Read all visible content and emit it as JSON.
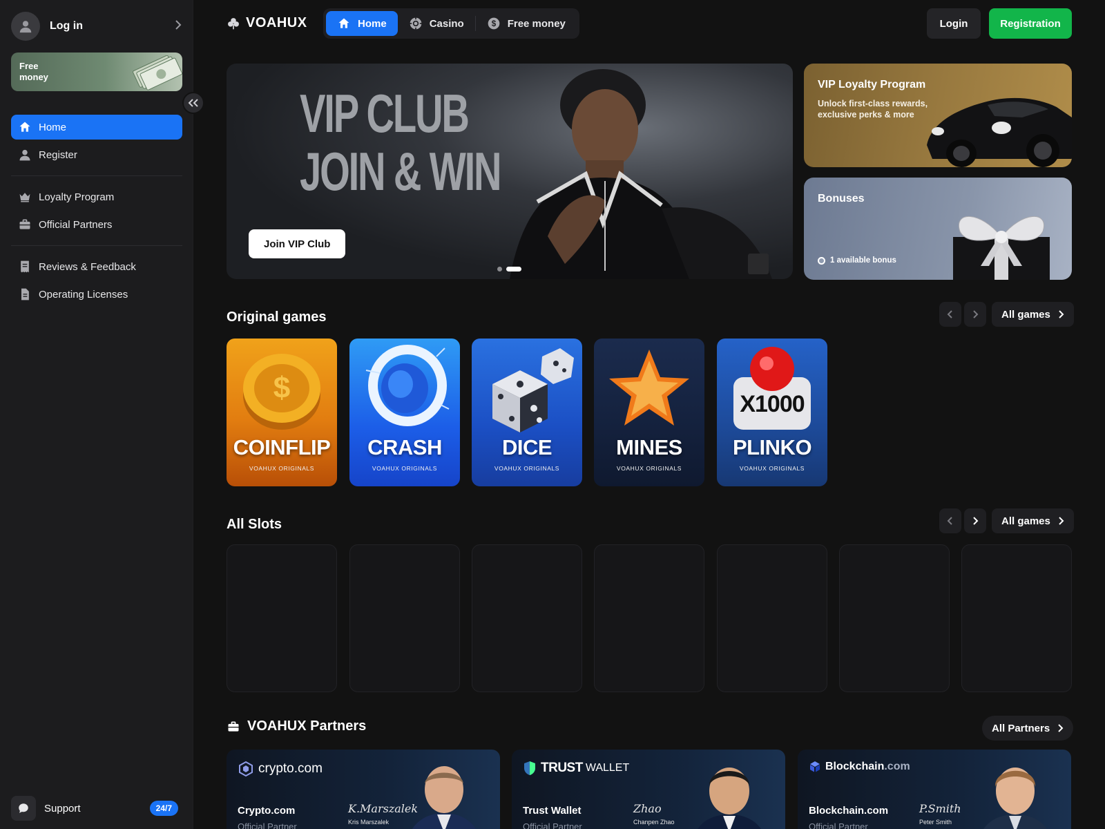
{
  "sidebar": {
    "login_label": "Log in",
    "free_money_label": "Free money",
    "nav_group1": [
      {
        "label": "Home",
        "icon": "home-icon",
        "active": true
      },
      {
        "label": "Register",
        "icon": "user-icon",
        "active": false
      }
    ],
    "nav_group2": [
      {
        "label": "Loyalty Program",
        "icon": "crown-icon"
      },
      {
        "label": "Official Partners",
        "icon": "briefcase-icon"
      }
    ],
    "nav_group3": [
      {
        "label": "Reviews & Feedback",
        "icon": "receipt-icon"
      },
      {
        "label": "Operating Licenses",
        "icon": "document-icon"
      }
    ],
    "support_label": "Support",
    "support_badge": "24/7"
  },
  "header": {
    "brand": "VOAHUX",
    "tabs": [
      {
        "label": "Home",
        "icon": "home-icon",
        "active": true
      },
      {
        "label": "Casino",
        "icon": "casino-chip-icon",
        "active": false
      },
      {
        "label": "Free money",
        "icon": "dollar-coin-icon",
        "active": false
      }
    ],
    "login_button": "Login",
    "registration_button": "Registration"
  },
  "hero": {
    "headline_line1": "VIP CLUB",
    "headline_line2": "JOIN & WIN",
    "cta": "Join VIP Club",
    "slides": 2,
    "active_slide": 2
  },
  "vip_card": {
    "title": "VIP Loyalty Program",
    "subtitle": "Unlock first-class rewards, exclusive perks & more"
  },
  "bonus_card": {
    "title": "Bonuses",
    "available": "1 available bonus"
  },
  "original_games": {
    "title": "Original games",
    "all_label": "All games",
    "games": [
      {
        "name": "COINFLIP",
        "sub": "VOAHUX ORIGINALS"
      },
      {
        "name": "CRASH",
        "sub": "VOAHUX ORIGINALS"
      },
      {
        "name": "DICE",
        "sub": "VOAHUX ORIGINALS"
      },
      {
        "name": "MINES",
        "sub": "VOAHUX ORIGINALS"
      },
      {
        "name": "PLINKO",
        "sub": "VOAHUX ORIGINALS"
      }
    ],
    "plinko_badge": "X1000"
  },
  "all_slots": {
    "title": "All Slots",
    "all_label": "All games",
    "placeholder_count": 7
  },
  "partners": {
    "title": "VOAHUX Partners",
    "all_label": "All Partners",
    "items": [
      {
        "logo": "crypto.com",
        "name": "Crypto.com",
        "role": "Official Partner",
        "signature": "K.Marszalek",
        "person": "Kris Marszalek"
      },
      {
        "logo_bold": "TRUST",
        "logo_light": "WALLET",
        "name": "Trust Wallet",
        "role": "Official Partner",
        "signature": "Zhao",
        "person": "Chanpen Zhao"
      },
      {
        "logo_bold": "Blockchain",
        "logo_light": ".com",
        "name": "Blockchain.com",
        "role": "Official Partner",
        "signature": "P.Smith",
        "person": "Peter Smith"
      }
    ]
  },
  "colors": {
    "accent": "#1a73f5",
    "registration": "#12b54a",
    "background": "#121212",
    "sidebar": "#1c1c1e"
  }
}
